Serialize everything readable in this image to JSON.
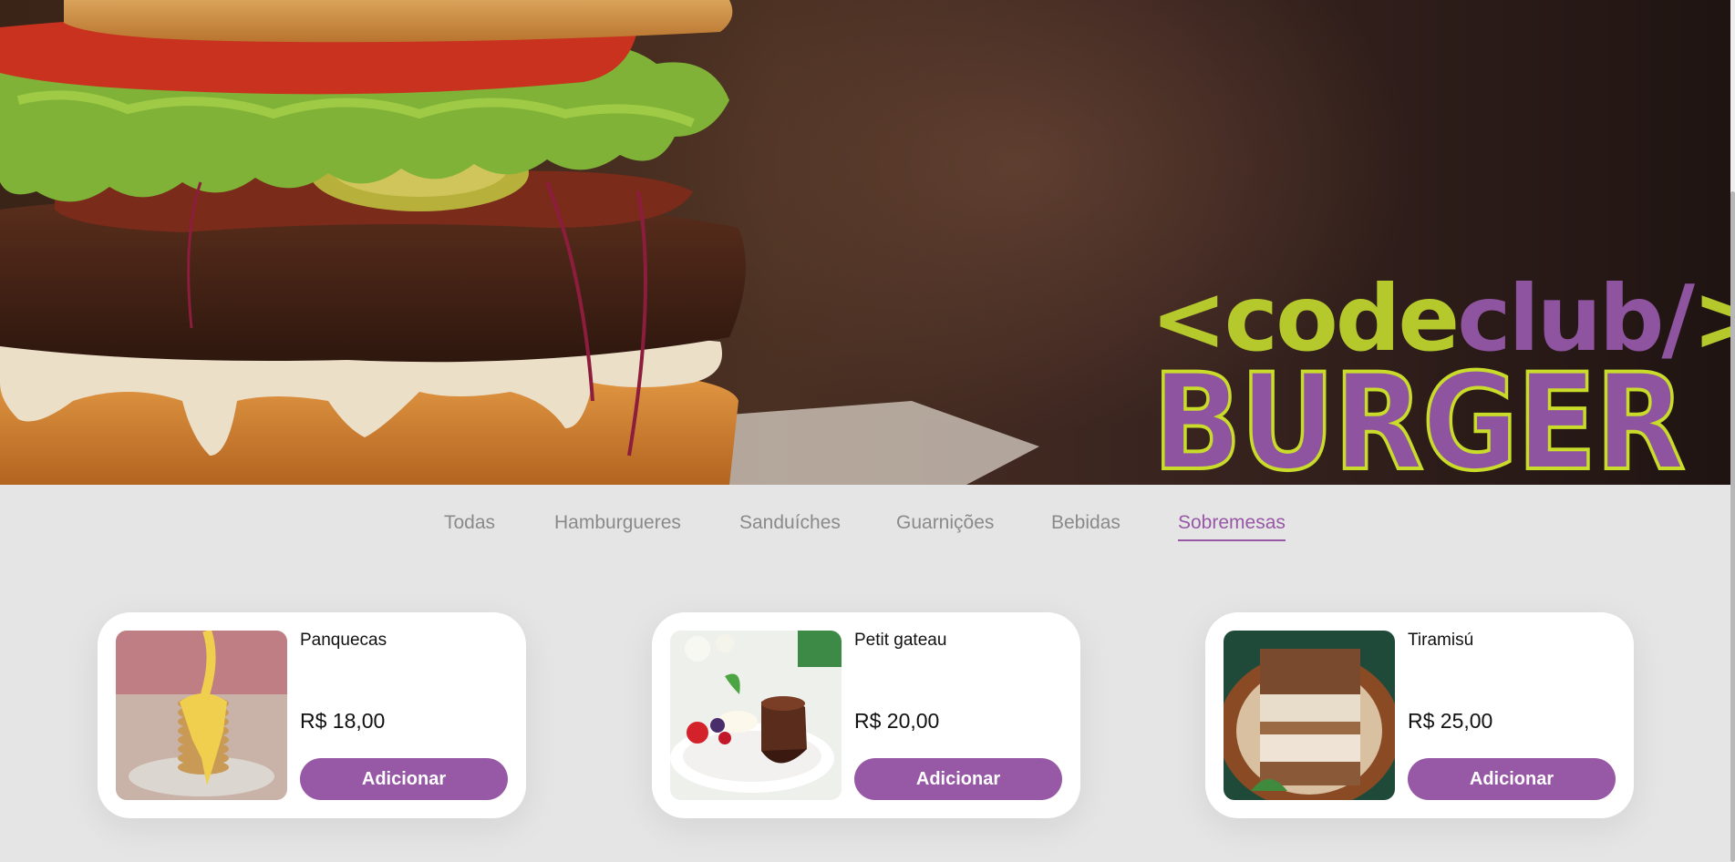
{
  "hero": {
    "logo_lt": "<",
    "logo_code": "code",
    "logo_club": "club/",
    "logo_gt": ">",
    "logo_burger": "BURGER"
  },
  "categories": {
    "items": [
      {
        "label": "Todas"
      },
      {
        "label": "Hamburgueres"
      },
      {
        "label": "Sanduíches"
      },
      {
        "label": "Guarnições"
      },
      {
        "label": "Bebidas"
      },
      {
        "label": "Sobremesas"
      }
    ],
    "active": "Sobremesas"
  },
  "products": [
    {
      "name": "Panquecas",
      "price": "R$ 18,00",
      "button": "Adicionar",
      "image_icon": "pancakes-image"
    },
    {
      "name": "Petit gateau",
      "price": "R$ 20,00",
      "button": "Adicionar",
      "image_icon": "petit-gateau-image"
    },
    {
      "name": "Tiramisú",
      "price": "R$ 25,00",
      "button": "Adicionar",
      "image_icon": "tiramisu-image"
    }
  ],
  "colors": {
    "brand_purple": "#9758a6",
    "brand_lime": "#b5c82c",
    "background": "#e5e5e5",
    "card": "#ffffff",
    "tab_inactive": "#8a8a8a"
  }
}
